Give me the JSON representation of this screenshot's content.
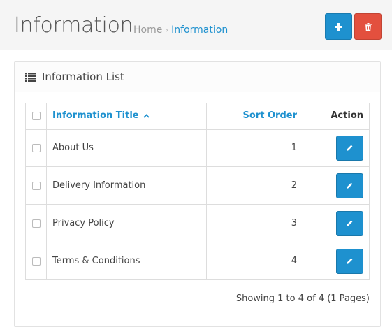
{
  "header": {
    "title": "Information",
    "breadcrumb": {
      "home": "Home",
      "separator": "›",
      "current": "Information"
    }
  },
  "actions": {
    "add_icon": "plus-icon",
    "delete_icon": "trash-icon"
  },
  "panel": {
    "title": "Information List",
    "icon": "list-icon",
    "columns": {
      "title": "Information Title",
      "sort_indicator": "^",
      "sort_order": "Sort Order",
      "action": "Action"
    },
    "rows": [
      {
        "title": "About Us",
        "sort_order": "1"
      },
      {
        "title": "Delivery Information",
        "sort_order": "2"
      },
      {
        "title": "Privacy Policy",
        "sort_order": "3"
      },
      {
        "title": "Terms & Conditions",
        "sort_order": "4"
      }
    ],
    "pagination": "Showing 1 to 4 of 4 (1 Pages)"
  },
  "colors": {
    "primary": "#1e91cf",
    "danger": "#e3503e"
  }
}
